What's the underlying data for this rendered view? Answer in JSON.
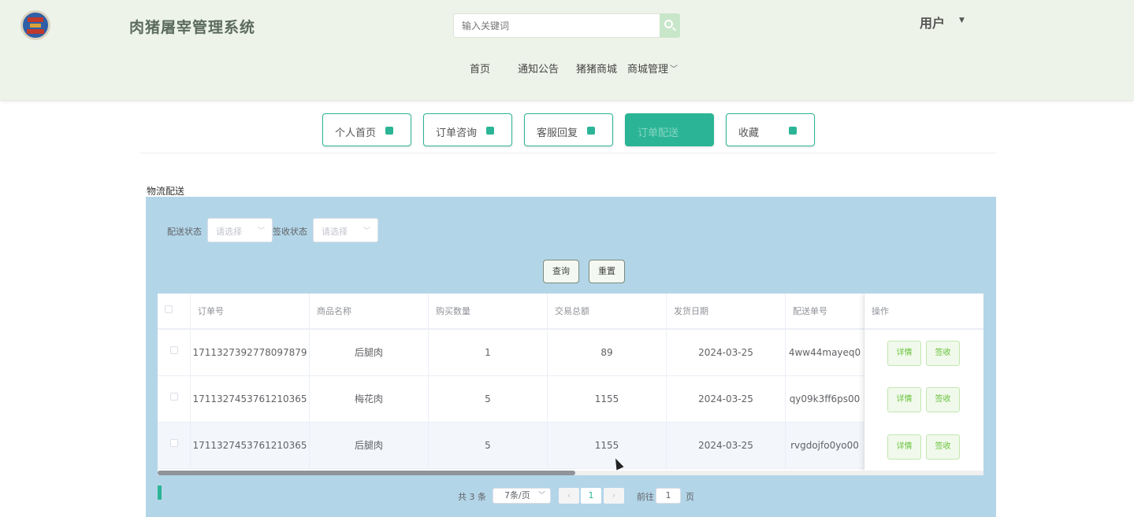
{
  "header": {
    "title": "肉猪屠宰管理系统",
    "search_placeholder": "输入关键词",
    "user": "用户"
  },
  "nav": [
    "首页",
    "通知公告",
    "猪猪商城",
    "商城管理"
  ],
  "sub_tabs": [
    {
      "label": "个人首页",
      "active": false
    },
    {
      "label": "订单咨询",
      "active": false
    },
    {
      "label": "客服回复",
      "active": false
    },
    {
      "label": "订单配送",
      "active": true
    },
    {
      "label": "收藏",
      "active": false
    }
  ],
  "section_title": "物流配送",
  "filters": [
    {
      "label": "配送状态",
      "placeholder": "请选择"
    },
    {
      "label": "签收状态",
      "placeholder": "请选择"
    }
  ],
  "buttons": {
    "query": "查询",
    "reset": "重置"
  },
  "table": {
    "columns": [
      "订单号",
      "商品名称",
      "购买数量",
      "交易总额",
      "发货日期",
      "配送单号",
      "操作"
    ],
    "rows": [
      [
        "1711327392778097879",
        "后腿肉",
        "1",
        "89",
        "2024-03-25",
        "4ww44mayeq0"
      ],
      [
        "1711327453761210365",
        "梅花肉",
        "5",
        "1155",
        "2024-03-25",
        "qy09k3ff6ps00"
      ],
      [
        "1711327453761210365",
        "后腿肉",
        "5",
        "1155",
        "2024-03-25",
        "rvgdojfo0yo00"
      ]
    ],
    "actions": {
      "detail": "详情",
      "sign": "签收"
    }
  },
  "pagination": {
    "total": "共 3 条",
    "page_size": "7条/页",
    "prev": "‹",
    "current": "1",
    "next": "›",
    "goto_label": "前往",
    "goto_value": "1",
    "page_suffix": "页"
  },
  "colors": {
    "accent": "#2bb596",
    "panel": "#b3d5e8",
    "header_bg": "#eef3ea"
  }
}
